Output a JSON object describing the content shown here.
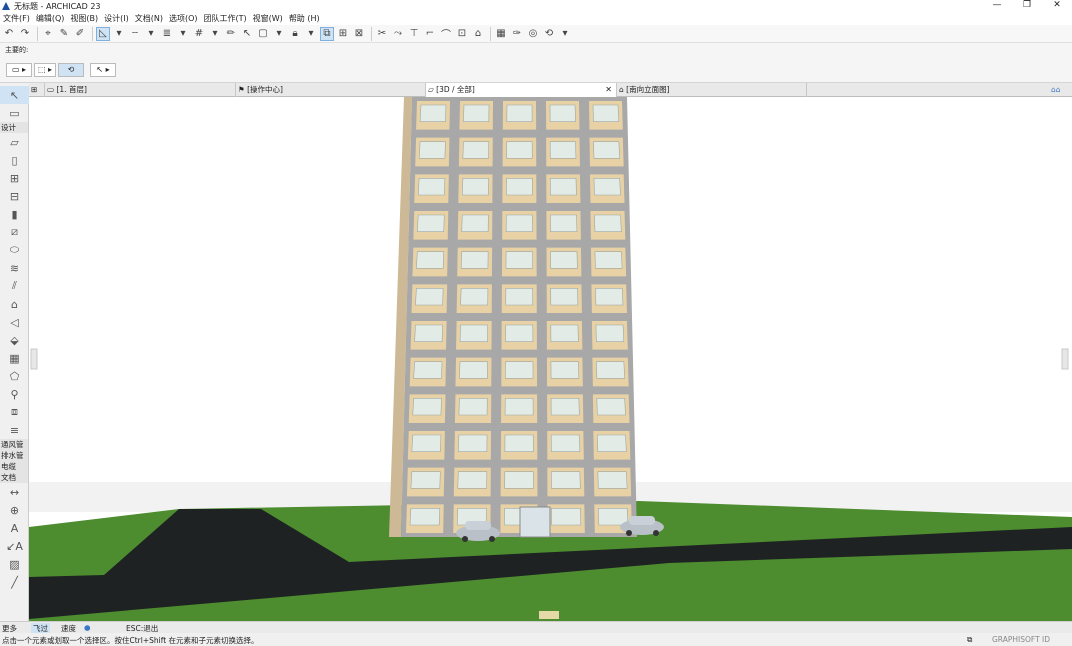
{
  "window": {
    "title": "无标题 - ARCHICAD 23",
    "minimize": "—",
    "restore": "❐",
    "close": "✕"
  },
  "menu": [
    "文件(F)",
    "编辑(Q)",
    "视图(B)",
    "设计(I)",
    "文档(N)",
    "选项(O)",
    "团队工作(T)",
    "视窗(W)",
    "帮助 (H)"
  ],
  "infobox": {
    "label": "主要的:"
  },
  "toolbox": {
    "sections": {
      "design": "设计",
      "ventilation": "通风管",
      "plumbing": "排水管",
      "electric": "电缆",
      "document": "文档",
      "more": "更多"
    }
  },
  "tabs": [
    {
      "label": "[1. 首层]"
    },
    {
      "label": "[操作中心]"
    },
    {
      "label": "[3D / 全部]"
    },
    {
      "label": "[南向立面图]"
    }
  ],
  "statusbar": {
    "mode": "飞过",
    "speed_label": "速度",
    "esc_hint": "ESC:退出",
    "hint": "点击一个元素或划取一个选择区。按住Ctrl+Shift 在元素和子元素切换选择。",
    "brand": "GRAPHISOFT ID"
  },
  "colors": {
    "accent": "#cfe3f5",
    "grass": "#4d8c2f",
    "road": "#1e2222",
    "facade": "#e7d1a5",
    "frame": "#a8a8a8"
  }
}
